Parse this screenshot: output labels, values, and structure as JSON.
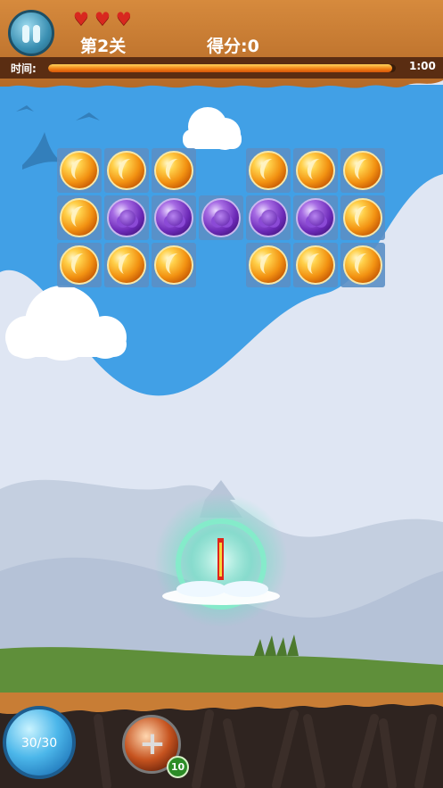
{
  "hud": {
    "lives": [
      "♥",
      "♥",
      "♥"
    ],
    "level_label": "第2关",
    "score_label": "得分:0",
    "time_label": "时间:",
    "time_value": "1:00",
    "time_progress": 1.0
  },
  "board": {
    "rows": [
      [
        "orange",
        "orange",
        "orange",
        "empty",
        "orange",
        "orange",
        "orange"
      ],
      [
        "orange",
        "purple",
        "purple",
        "purple",
        "purple",
        "purple",
        "orange"
      ],
      [
        "orange",
        "orange",
        "orange",
        "empty",
        "orange",
        "orange",
        "orange"
      ]
    ]
  },
  "bottom": {
    "ammo_label": "30/30",
    "booster_count": "10"
  },
  "colors": {
    "hud_brown": "#c87d35",
    "sky_blue": "#3f9be1",
    "grass_green": "#5f8f3a",
    "progress_orange": "#f07c12"
  },
  "icons": {
    "pause": "pause-icon",
    "heart": "heart-icon",
    "booster": "plus-icon"
  }
}
